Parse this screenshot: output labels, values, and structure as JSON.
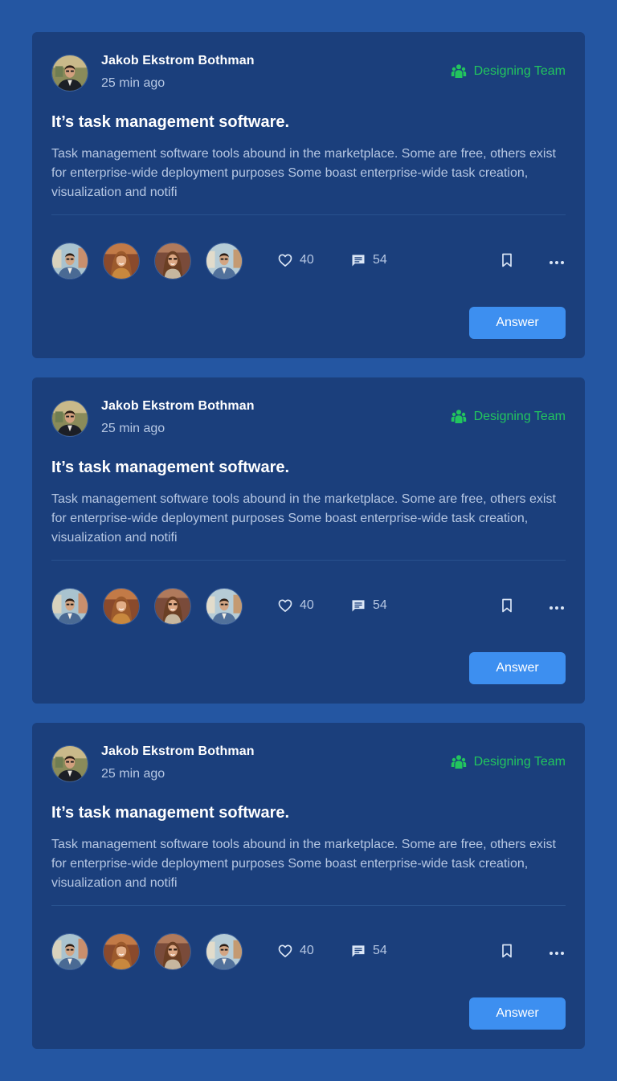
{
  "posts": [
    {
      "author": "Jakob Ekstrom Bothman",
      "time": "25 min ago",
      "team": "Designing Team",
      "title": "It’s task management software.",
      "body": "Task management software tools abound in the marketplace. Some are free, others exist for enterprise-wide deployment purposes Some boast enterprise-wide task creation, visualization and notifi",
      "likes": "40",
      "comments": "54",
      "answer_label": "Answer"
    },
    {
      "author": "Jakob Ekstrom Bothman",
      "time": "25 min ago",
      "team": "Designing Team",
      "title": "It’s task management software.",
      "body": "Task management software tools abound in the marketplace. Some are free, others exist for enterprise-wide deployment purposes Some boast enterprise-wide task creation, visualization and notifi",
      "likes": "40",
      "comments": "54",
      "answer_label": "Answer"
    },
    {
      "author": "Jakob Ekstrom Bothman",
      "time": "25 min ago",
      "team": "Designing Team",
      "title": "It’s task management software.",
      "body": "Task management software tools abound in the marketplace. Some are free, others exist for enterprise-wide deployment purposes Some boast enterprise-wide task creation, visualization and notifi",
      "likes": "40",
      "comments": "54",
      "answer_label": "Answer"
    }
  ],
  "icons": {
    "team": "team-icon",
    "like": "heart-icon",
    "comment": "comment-icon",
    "bookmark": "bookmark-icon",
    "more": "more-horizontal-icon"
  },
  "colors": {
    "page_background": "#2456a2",
    "card_background": "#1b3f7c",
    "team_accent": "#22c55e",
    "button": "#3d8ff0",
    "muted_text": "#b6c7e3"
  }
}
